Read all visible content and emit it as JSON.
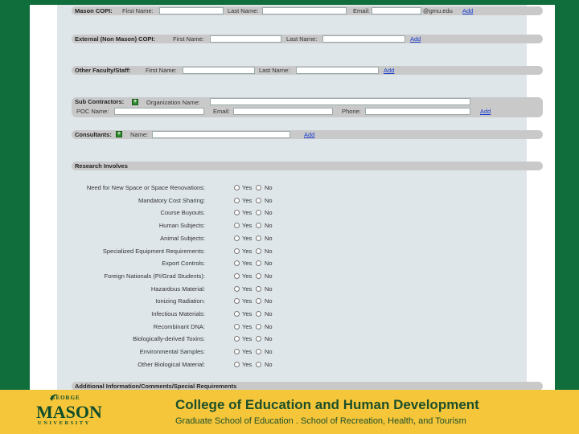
{
  "mason_copi": {
    "title": "Mason COPI:",
    "first_label": "First Name:",
    "last_label": "Last Name:",
    "email_label": "Email:",
    "email_suffix": "@gmu.edu",
    "add": "Add"
  },
  "external_copi": {
    "title": "External (Non Mason) COPI:",
    "first_label": "First Name:",
    "last_label": "Last Name:",
    "add": "Add"
  },
  "other_staff": {
    "title": "Other Faculty/Staff:",
    "first_label": "First Name:",
    "last_label": "Last Name:",
    "add": "Add"
  },
  "subcontractors": {
    "title": "Sub Contractors:",
    "org_label": "Organization Name:",
    "poc_label": "POC Name:",
    "email_label": "Email:",
    "phone_label": "Phone:",
    "add": "Add"
  },
  "consultants": {
    "title": "Consultants:",
    "name_label": "Name:",
    "add": "Add"
  },
  "research": {
    "title": "Research Involves",
    "yes": "Yes",
    "no": "No",
    "questions": [
      "Need for New Space or Space Renovations:",
      "Mandatory Cost Sharing:",
      "Course Buyouts:",
      "Human Subjects:",
      "Animal Subjects:",
      "Specialized Equipment Requirements:",
      "Export Controls:",
      "Foreign Nationals (PI/Grad Students):",
      "Hazardous Material:",
      "Ionizing Radiation:",
      "Infectious Materials:",
      "Recombinant DNA:",
      "Biologically-derived Toxins:",
      "Environmental Samples:",
      "Other Biological Material:"
    ]
  },
  "additional": {
    "title": "Additional Information/Comments/Special Requirements"
  },
  "footer": {
    "logo_top": "GEORGE",
    "logo_main": "MASON",
    "logo_bottom": "UNIVERSITY",
    "college": "College of Education and Human Development",
    "schools": "Graduate School of Education . School of Recreation, Health, and Tourism",
    "brand_green": "#1b4f2a",
    "brand_gold": "#f6c63a"
  }
}
